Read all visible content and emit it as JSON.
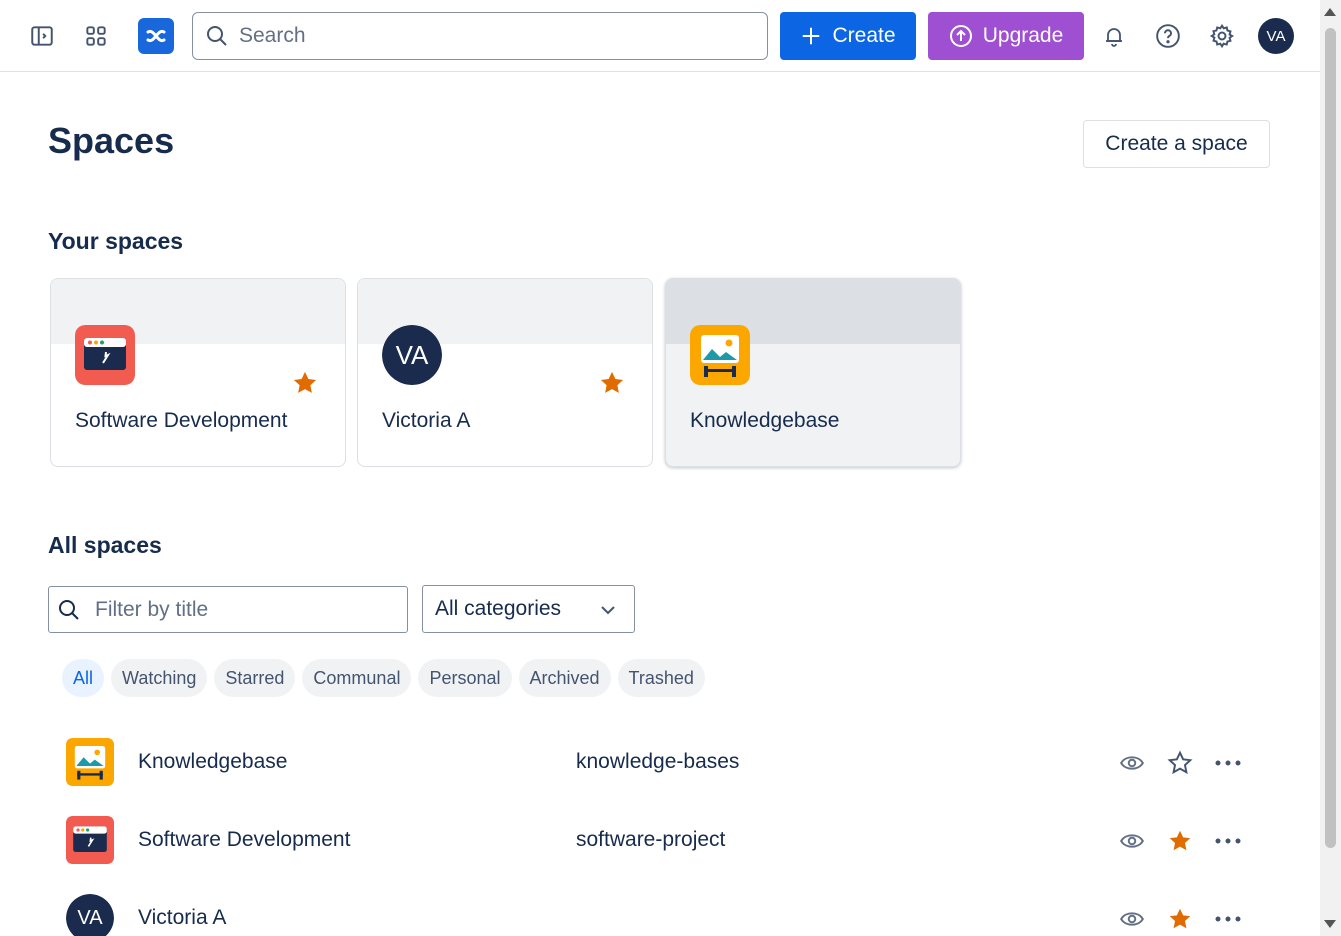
{
  "header": {
    "search_placeholder": "Search",
    "create_label": "Create",
    "upgrade_label": "Upgrade",
    "avatar_initials": "VA"
  },
  "page": {
    "title": "Spaces",
    "create_space_label": "Create a space"
  },
  "your_spaces": {
    "title": "Your spaces",
    "cards": [
      {
        "name": "Software Development",
        "icon": "software-dev-icon",
        "starred": true
      },
      {
        "name": "Victoria A",
        "icon": "avatar",
        "initials": "VA",
        "starred": true
      },
      {
        "name": "Knowledgebase",
        "icon": "knowledgebase-icon",
        "starred": false
      }
    ]
  },
  "all_spaces": {
    "title": "All spaces",
    "filter_placeholder": "Filter by title",
    "category_selected": "All categories",
    "chips": [
      "All",
      "Watching",
      "Starred",
      "Communal",
      "Personal",
      "Archived",
      "Trashed"
    ],
    "active_chip": "All",
    "rows": [
      {
        "name": "Knowledgebase",
        "key": "knowledge-bases",
        "starred": false
      },
      {
        "name": "Software Development",
        "key": "software-project",
        "starred": true
      },
      {
        "name": "Victoria A",
        "key": "",
        "initials": "VA",
        "starred": true
      }
    ]
  },
  "colors": {
    "primary": "#0c66e4",
    "upgrade": "#9f4fd1",
    "star": "#e06c00",
    "avatar": "#1b2b4d",
    "software_icon": "#f15b50",
    "knowledge_icon": "#fca700"
  }
}
